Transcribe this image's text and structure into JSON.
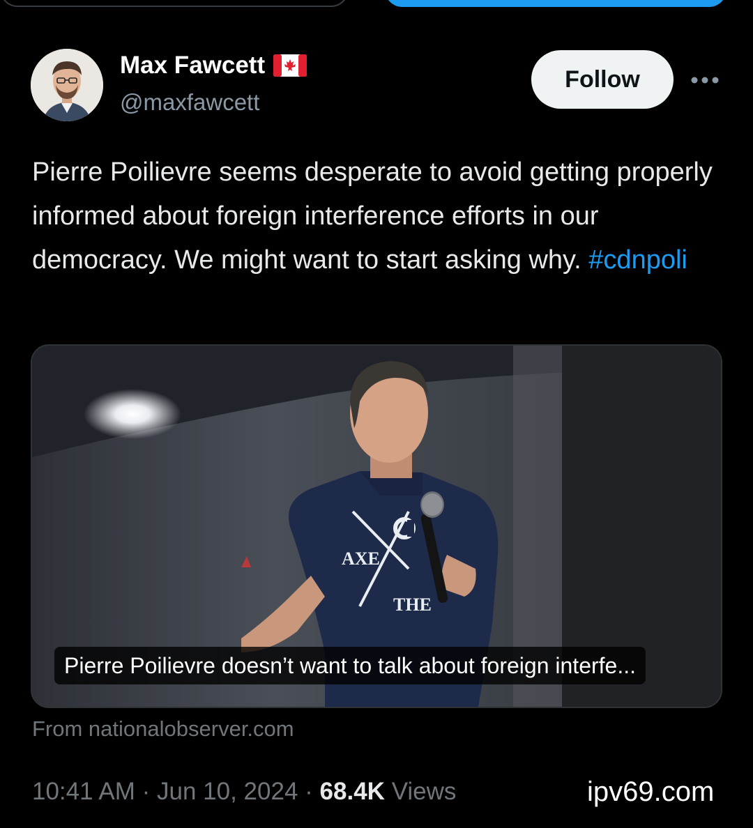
{
  "colors": {
    "background": "#000000",
    "primary_text": "#e7e9ea",
    "secondary_text": "#71767b",
    "accent_blue": "#1d9bf0",
    "follow_bg": "#eff3f4"
  },
  "author": {
    "display_name": "Max Fawcett",
    "flag_icon": "canada-flag-icon",
    "handle": "@maxfawcett"
  },
  "actions": {
    "follow_label": "Follow",
    "more_icon": "more-horizontal-icon"
  },
  "tweet": {
    "text": "Pierre Poilievre seems desperate to avoid getting properly informed about foreign interference efforts in our democracy. We might want to start asking why. ",
    "hashtag": "#cdnpoli"
  },
  "link_card": {
    "shirt_text_1": "AXE",
    "shirt_text_2": "THE",
    "caption": "Pierre Poilievre doesn’t want to talk about foreign interfe...",
    "source": "From nationalobserver.com"
  },
  "meta": {
    "time": "10:41 AM",
    "separator": "·",
    "date": "Jun 10, 2024",
    "views_count": "68.4K",
    "views_label": "Views"
  },
  "watermark": "ipv69.com"
}
